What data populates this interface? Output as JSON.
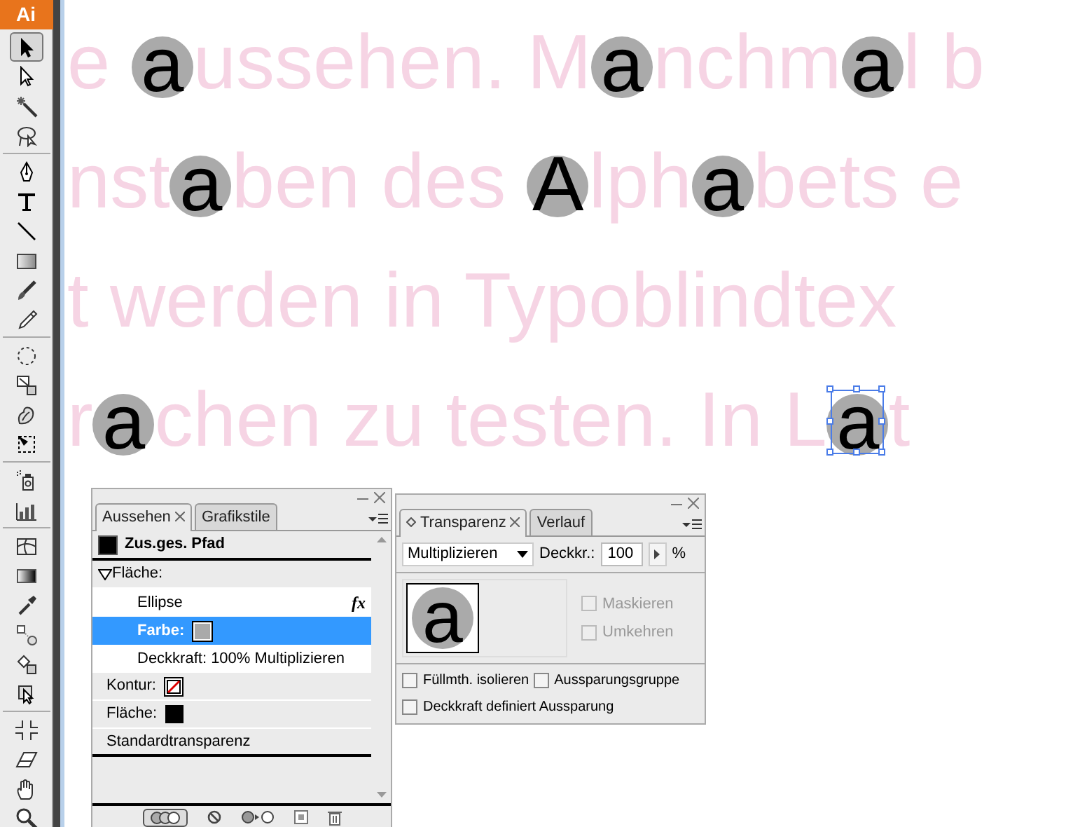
{
  "toolbar": {
    "logo": "Ai",
    "tool_groups": [
      [
        {
          "kind": "select",
          "selected": true
        },
        {
          "kind": "direct-select",
          "selected": false
        },
        {
          "kind": "wand",
          "selected": false
        },
        {
          "kind": "lasso",
          "selected": false
        }
      ],
      [
        {
          "kind": "pen",
          "selected": false
        },
        {
          "kind": "type",
          "selected": false
        },
        {
          "kind": "line",
          "selected": false
        },
        {
          "kind": "rectangle",
          "selected": false
        },
        {
          "kind": "brush",
          "selected": false
        },
        {
          "kind": "pencil",
          "selected": false
        }
      ],
      [
        {
          "kind": "rotate",
          "selected": false
        },
        {
          "kind": "scale",
          "selected": false
        },
        {
          "kind": "warp",
          "selected": false
        },
        {
          "kind": "free-transform",
          "selected": false
        }
      ],
      [
        {
          "kind": "sprayer",
          "selected": false
        },
        {
          "kind": "graph",
          "selected": false
        }
      ],
      [
        {
          "kind": "mesh",
          "selected": false
        },
        {
          "kind": "gradient",
          "selected": false
        },
        {
          "kind": "eyedropper",
          "selected": false
        },
        {
          "kind": "blend",
          "selected": false
        },
        {
          "kind": "live-paint",
          "selected": false
        },
        {
          "kind": "live-paint-select",
          "selected": false
        }
      ],
      [
        {
          "kind": "slice",
          "selected": false
        },
        {
          "kind": "eraser",
          "selected": false
        },
        {
          "kind": "hand",
          "selected": false
        },
        {
          "kind": "zoom",
          "selected": false
        }
      ]
    ]
  },
  "canvas": {
    "lines": [
      [
        {
          "kind": "text",
          "text": "e "
        },
        {
          "kind": "marker",
          "text": "a",
          "selected": false
        },
        {
          "kind": "text",
          "text": "ussehen. M"
        },
        {
          "kind": "marker",
          "text": "a",
          "selected": false
        },
        {
          "kind": "text",
          "text": "nchm"
        },
        {
          "kind": "marker",
          "text": "a",
          "selected": false
        },
        {
          "kind": "text",
          "text": "l b"
        }
      ],
      [
        {
          "kind": "text",
          "text": "nst"
        },
        {
          "kind": "marker",
          "text": "a",
          "selected": false
        },
        {
          "kind": "text",
          "text": "ben des "
        },
        {
          "kind": "marker",
          "text": "A",
          "selected": false
        },
        {
          "kind": "text",
          "text": "lph"
        },
        {
          "kind": "marker",
          "text": "a",
          "selected": false
        },
        {
          "kind": "text",
          "text": "bets e"
        }
      ],
      [
        {
          "kind": "text",
          "text": "t werden in Typoblindtex"
        }
      ],
      [
        {
          "kind": "text",
          "text": "r"
        },
        {
          "kind": "marker",
          "text": "a",
          "selected": false
        },
        {
          "kind": "text",
          "text": "chen zu testen. In L"
        },
        {
          "kind": "marker",
          "text": "a",
          "selected": true
        },
        {
          "kind": "text",
          "text": "t"
        }
      ]
    ]
  },
  "appearance_panel": {
    "tabs": [
      {
        "label": "Aussehen",
        "selected": true
      },
      {
        "label": "Grafikstile",
        "selected": false
      }
    ],
    "target": {
      "label": "Zus.ges. Pfad",
      "color": "#000000"
    },
    "items": [
      {
        "kind": "group",
        "label": "Fläche:",
        "expanded": true,
        "selected": false,
        "children": [
          {
            "kind": "effect",
            "label": "Ellipse",
            "badge": "fx",
            "selected": false
          },
          {
            "kind": "swatch",
            "label": "Farbe:",
            "color": "#aaaaaa",
            "selected": true
          },
          {
            "kind": "plain",
            "label": "Deckkraft: 100% Multiplizieren",
            "selected": false
          }
        ]
      },
      {
        "kind": "swatch-none",
        "label": "Kontur:",
        "selected": false
      },
      {
        "kind": "swatch",
        "label": "Fläche:",
        "color": "#000000",
        "selected": false
      },
      {
        "kind": "plain",
        "label": "Standardtransparenz",
        "selected": false
      }
    ]
  },
  "transparency_panel": {
    "tabs": [
      {
        "label": "Transparenz",
        "selected": true
      },
      {
        "label": "Verlauf",
        "selected": false
      }
    ],
    "blend_mode": "Multiplizieren",
    "opacity_label": "Deckkr.:",
    "opacity": "100",
    "unit": "%",
    "thumbnail_letter": "a",
    "mask_options": [
      {
        "label": "Maskieren",
        "checked": false,
        "disabled": true
      },
      {
        "label": "Umkehren",
        "checked": false,
        "disabled": true
      }
    ],
    "options": [
      {
        "label": "Füllmth. isolieren",
        "checked": false,
        "disabled": false
      },
      {
        "label": "Aussparungsgruppe",
        "checked": false,
        "disabled": false
      },
      {
        "label": "Deckkraft definiert Aussparung",
        "checked": false,
        "disabled": false
      }
    ]
  }
}
